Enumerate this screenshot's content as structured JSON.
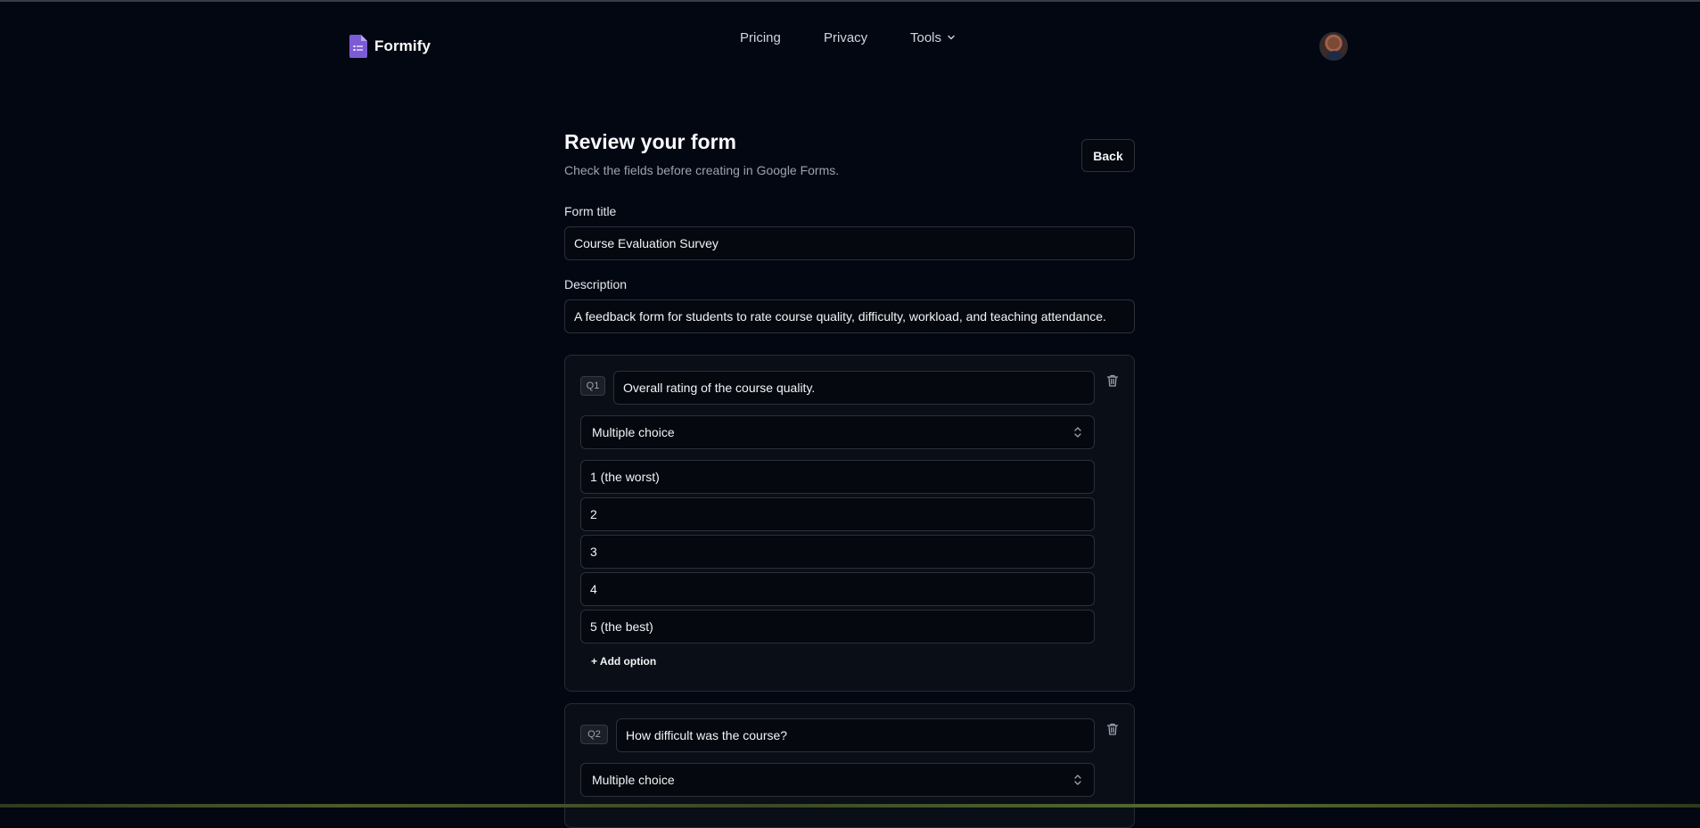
{
  "header": {
    "brand_name": "Formify",
    "brand_color": "#7c5cd6",
    "nav": {
      "pricing": "Pricing",
      "privacy": "Privacy",
      "tools": "Tools"
    }
  },
  "main": {
    "title": "Review your form",
    "subtitle": "Check the fields before creating in Google Forms.",
    "back_label": "Back",
    "form_title_label": "Form title",
    "form_title_value": "Course Evaluation Survey",
    "description_label": "Description",
    "description_value": "A feedback form for students to rate course quality, difficulty, workload, and teaching attendance."
  },
  "questions": [
    {
      "badge": "Q1",
      "text": "Overall rating of the course quality.",
      "type": "Multiple choice",
      "options": [
        "1 (the worst)",
        "2",
        "3",
        "4",
        "5 (the best)"
      ],
      "add_option_label": "+ Add option"
    },
    {
      "badge": "Q2",
      "text": "How difficult was the course?",
      "type": "Multiple choice"
    }
  ]
}
